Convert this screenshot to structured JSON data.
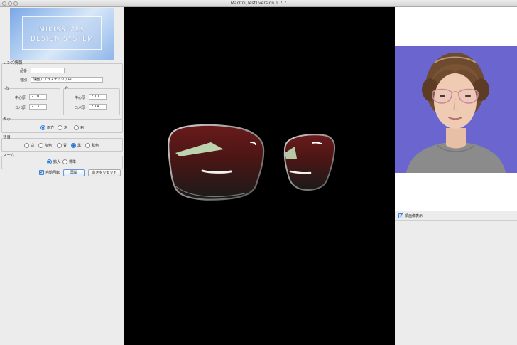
{
  "window": {
    "title": "MacCG(Test) version 1.7.7"
  },
  "logo": {
    "line1": "MIKISSIMES",
    "line2": "DESIGN SYSTEM"
  },
  "lens_info": {
    "group_label": "レンズ情報",
    "product_label": "品番",
    "product_value": "",
    "type_label": "種別",
    "type_value": "球面 / プラスチック / 中"
  },
  "right_lens": {
    "group_label": "右",
    "center_label": "中心厚",
    "center_value": "2.10",
    "edge_label": "コバ厚",
    "edge_value": "2.13"
  },
  "left_lens": {
    "group_label": "左",
    "center_label": "中心厚",
    "center_value": "2.10",
    "edge_label": "コバ厚",
    "edge_value": "2.14"
  },
  "display": {
    "group_label": "表示",
    "options": [
      "両方",
      "左",
      "右"
    ],
    "selected": "両方"
  },
  "background": {
    "group_label": "背景",
    "options": [
      "白",
      "灰色",
      "青",
      "黒",
      "肌色"
    ],
    "selected": "黒"
  },
  "zoom": {
    "group_label": "ズーム",
    "options": [
      "拡大",
      "標準"
    ],
    "selected": "拡大"
  },
  "controls": {
    "auto_rotate_label": "自動回転",
    "auto_rotate_checked": true,
    "replay_label": "再開",
    "reset_label": "向きをリセット"
  },
  "right_panel": {
    "face_image_label": "顔画像表示",
    "face_image_checked": true,
    "photo_bg_color": "#6b66cf"
  },
  "colors": {
    "lens_tint": "#5a1a18",
    "view_bg": "#000000",
    "accent": "#1a6fd9"
  }
}
